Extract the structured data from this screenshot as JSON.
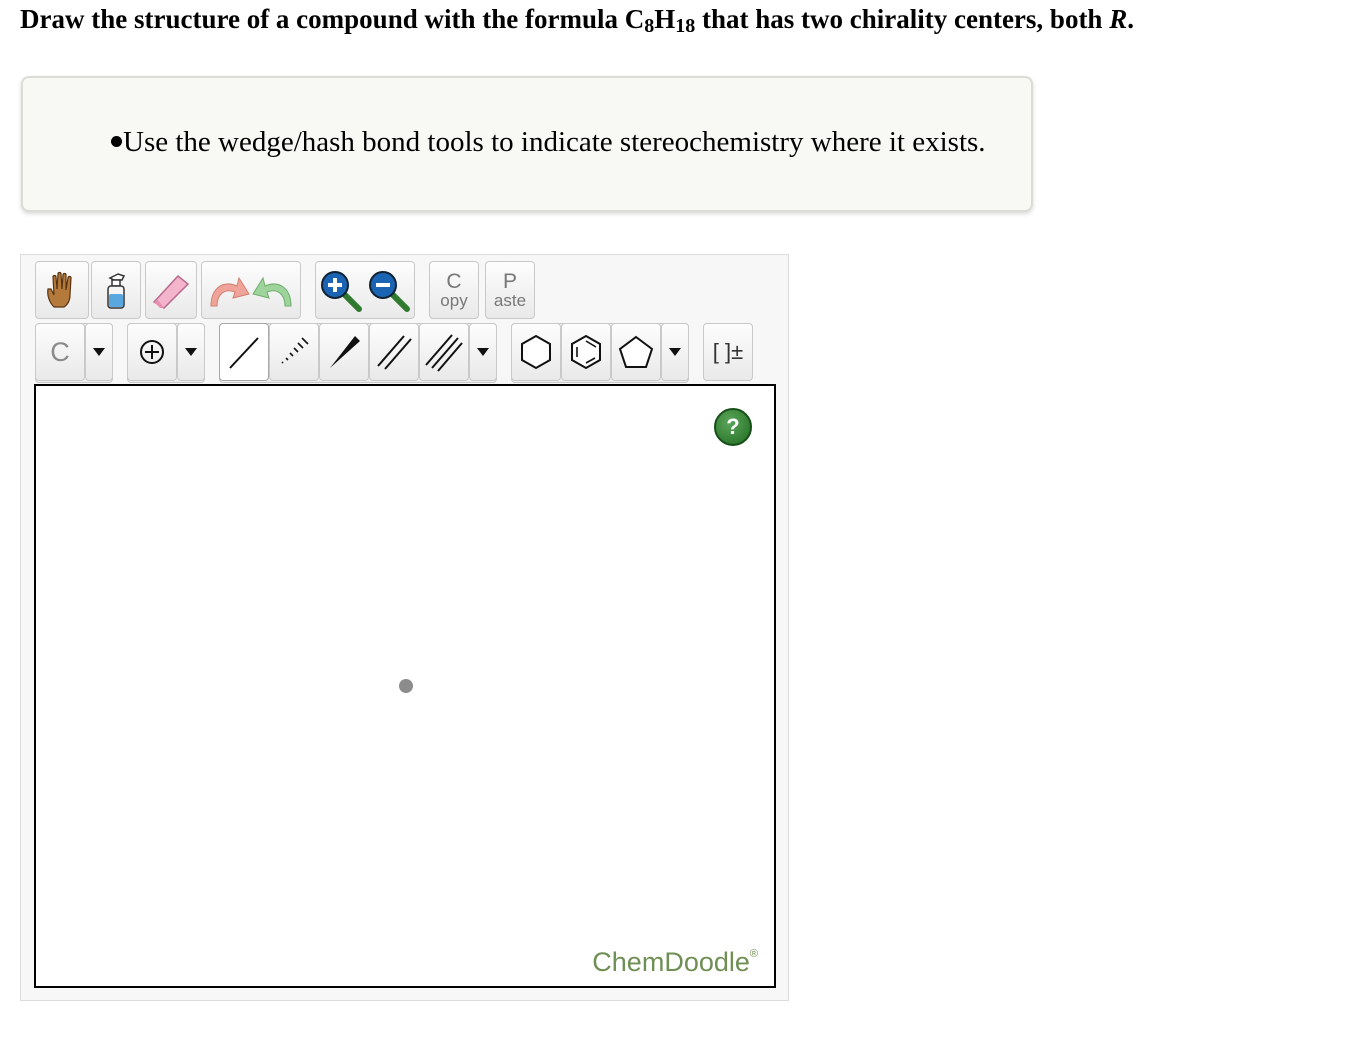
{
  "question": {
    "part1": "Draw the structure of a compound with the formula C",
    "sub1": "8",
    "part2": "H",
    "sub2": "18",
    "part3": " that has two chirality centers, both ",
    "italic": "R",
    "part4": "."
  },
  "hint": {
    "items": [
      "Use the wedge/hash bond tools to indicate stereochemistry where it exists."
    ]
  },
  "toolbar": {
    "copy": {
      "top": "C",
      "bottom": "opy"
    },
    "paste": {
      "top": "P",
      "bottom": "aste"
    },
    "atom_label": "C",
    "charge_label": "[ ]±"
  },
  "canvas": {
    "help_label": "?",
    "brand": "ChemDoodle",
    "brand_mark": "®"
  },
  "colors": {
    "hint_bg": "#f8f9f4",
    "brand_green": "#6f8f55",
    "help_green": "#2e7d32"
  }
}
